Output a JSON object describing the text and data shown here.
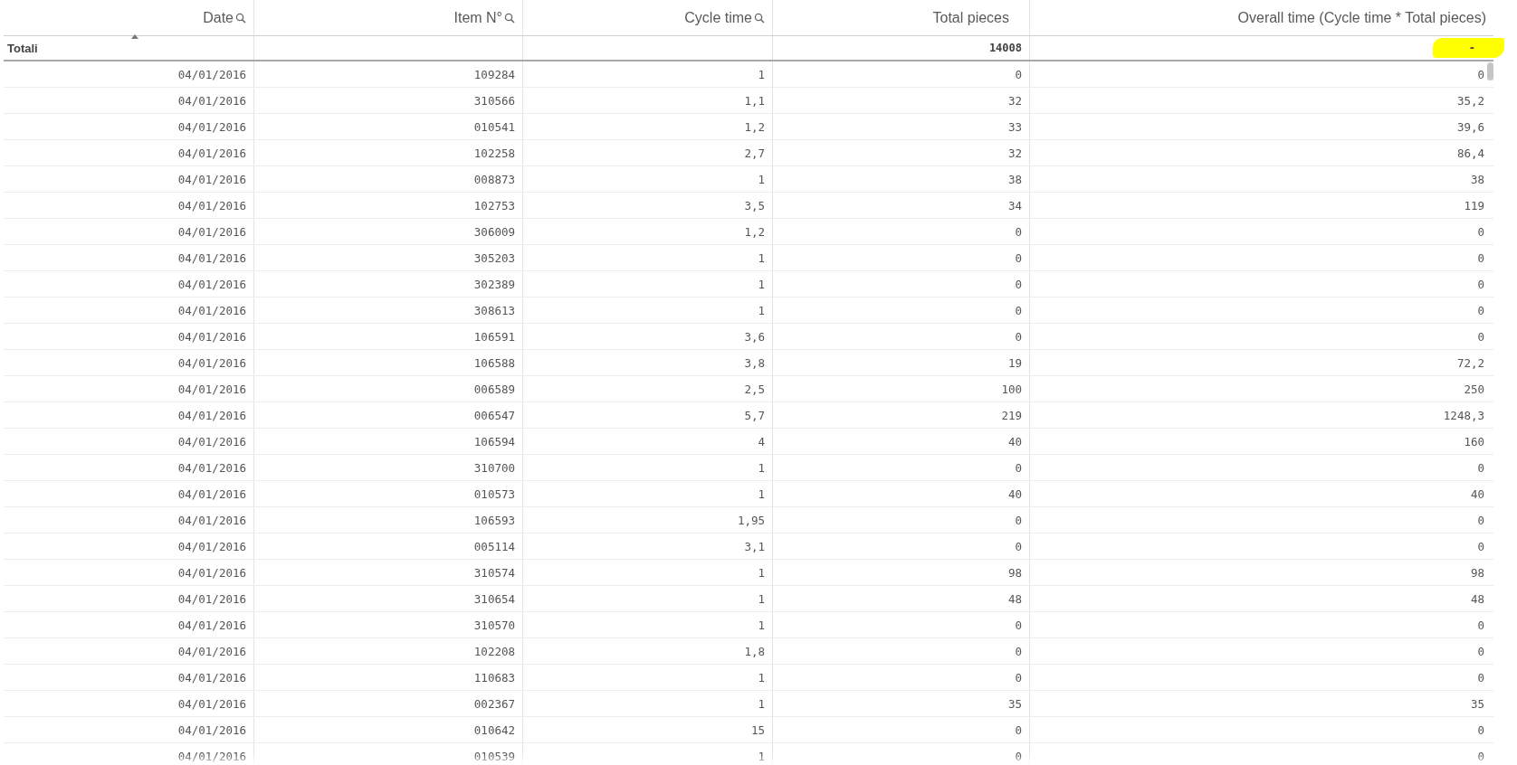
{
  "columns": [
    {
      "label": "Date",
      "searchable": true,
      "sorted": true
    },
    {
      "label": "Item N°",
      "searchable": true,
      "sorted": false
    },
    {
      "label": "Cycle time",
      "searchable": true,
      "sorted": false
    },
    {
      "label": "Total pieces",
      "searchable": false,
      "sorted": false,
      "total": "14008",
      "total_highlighted": false
    },
    {
      "label": "Overall time (Cycle time * Total pieces)",
      "searchable": false,
      "sorted": false,
      "total": "-",
      "total_highlighted": true
    }
  ],
  "totals_label": "Totali",
  "rows": [
    [
      "04/01/2016",
      "109284",
      "1",
      "0",
      "0"
    ],
    [
      "04/01/2016",
      "310566",
      "1,1",
      "32",
      "35,2"
    ],
    [
      "04/01/2016",
      "010541",
      "1,2",
      "33",
      "39,6"
    ],
    [
      "04/01/2016",
      "102258",
      "2,7",
      "32",
      "86,4"
    ],
    [
      "04/01/2016",
      "008873",
      "1",
      "38",
      "38"
    ],
    [
      "04/01/2016",
      "102753",
      "3,5",
      "34",
      "119"
    ],
    [
      "04/01/2016",
      "306009",
      "1,2",
      "0",
      "0"
    ],
    [
      "04/01/2016",
      "305203",
      "1",
      "0",
      "0"
    ],
    [
      "04/01/2016",
      "302389",
      "1",
      "0",
      "0"
    ],
    [
      "04/01/2016",
      "308613",
      "1",
      "0",
      "0"
    ],
    [
      "04/01/2016",
      "106591",
      "3,6",
      "0",
      "0"
    ],
    [
      "04/01/2016",
      "106588",
      "3,8",
      "19",
      "72,2"
    ],
    [
      "04/01/2016",
      "006589",
      "2,5",
      "100",
      "250"
    ],
    [
      "04/01/2016",
      "006547",
      "5,7",
      "219",
      "1248,3"
    ],
    [
      "04/01/2016",
      "106594",
      "4",
      "40",
      "160"
    ],
    [
      "04/01/2016",
      "310700",
      "1",
      "0",
      "0"
    ],
    [
      "04/01/2016",
      "010573",
      "1",
      "40",
      "40"
    ],
    [
      "04/01/2016",
      "106593",
      "1,95",
      "0",
      "0"
    ],
    [
      "04/01/2016",
      "005114",
      "3,1",
      "0",
      "0"
    ],
    [
      "04/01/2016",
      "310574",
      "1",
      "98",
      "98"
    ],
    [
      "04/01/2016",
      "310654",
      "1",
      "48",
      "48"
    ],
    [
      "04/01/2016",
      "310570",
      "1",
      "0",
      "0"
    ],
    [
      "04/01/2016",
      "102208",
      "1,8",
      "0",
      "0"
    ],
    [
      "04/01/2016",
      "110683",
      "1",
      "0",
      "0"
    ],
    [
      "04/01/2016",
      "002367",
      "1",
      "35",
      "35"
    ],
    [
      "04/01/2016",
      "010642",
      "15",
      "0",
      "0"
    ],
    [
      "04/01/2016",
      "010539",
      "1",
      "0",
      "0"
    ]
  ]
}
